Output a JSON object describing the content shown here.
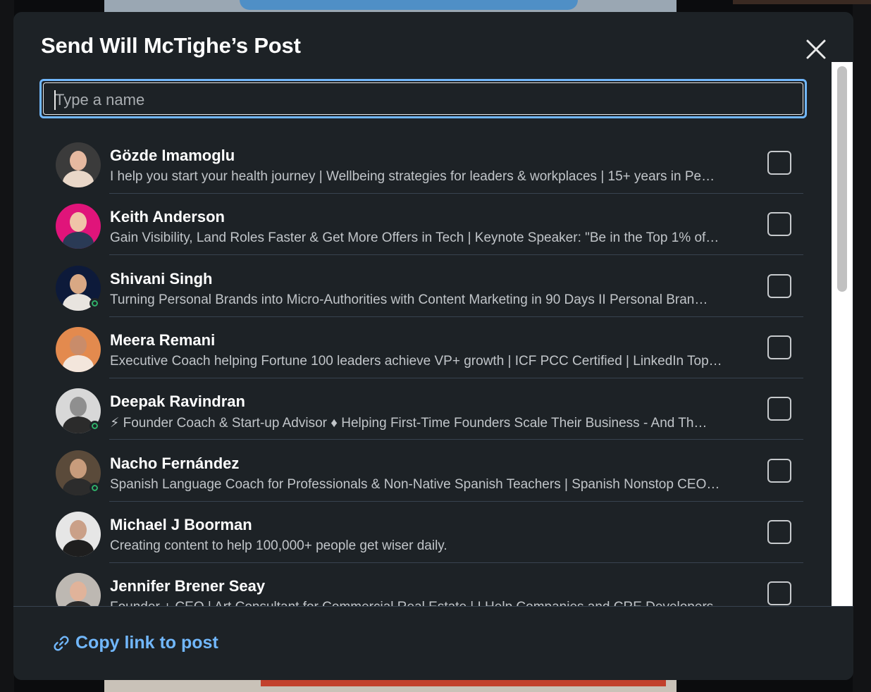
{
  "modal": {
    "title": "Send Will McTighe’s Post",
    "close_icon": "close-icon"
  },
  "search": {
    "placeholder": "Type a name",
    "value": ""
  },
  "contacts": [
    {
      "name": "Gözde Imamoglu",
      "headline": "I help you start your health journey | Wellbeing strategies for leaders & workplaces | 15+ years in Pe…",
      "online": false,
      "checked": false,
      "avatar_bg": "#3b3b3b",
      "avatar_skin": "#e6b9a0",
      "avatar_shirt": "#e9d7c8"
    },
    {
      "name": "Keith Anderson",
      "headline": "Gain Visibility, Land Roles Faster & Get More Offers in Tech | Keynote Speaker: \"Be in the Top 1% of…",
      "online": false,
      "checked": false,
      "avatar_bg": "#e0147a",
      "avatar_skin": "#f0c4a8",
      "avatar_shirt": "#2a3a55"
    },
    {
      "name": "Shivani Singh",
      "headline": "Turning Personal Brands into Micro-Authorities with Content Marketing in 90 Days II Personal Bran…",
      "online": true,
      "checked": false,
      "avatar_bg": "#0d1a3a",
      "avatar_skin": "#d9a884",
      "avatar_shirt": "#e8e4df"
    },
    {
      "name": "Meera Remani",
      "headline": "Executive Coach helping Fortune 100 leaders achieve VP+ growth | ICF PCC Certified | LinkedIn Top…",
      "online": false,
      "checked": false,
      "avatar_bg": "#e38a4e",
      "avatar_skin": "#c98c6a",
      "avatar_shirt": "#f3e6dc"
    },
    {
      "name": "Deepak Ravindran",
      "headline": "⚡ Founder Coach & Start-up Advisor ♦ Helping First-Time Founders Scale Their Business - And Th…",
      "online": true,
      "checked": false,
      "avatar_bg": "#d8d8d8",
      "avatar_skin": "#8f8f8f",
      "avatar_shirt": "#2b2b2b"
    },
    {
      "name": "Nacho Fernández",
      "headline": "Spanish Language Coach for Professionals & Non-Native Spanish Teachers | Spanish Nonstop CEO…",
      "online": true,
      "checked": false,
      "avatar_bg": "#5a4a3a",
      "avatar_skin": "#c89c7c",
      "avatar_shirt": "#2c2c2c"
    },
    {
      "name": "Michael J Boorman",
      "headline": "Creating content to help 100,000+ people get wiser daily.",
      "online": false,
      "checked": false,
      "avatar_bg": "#e6e6e6",
      "avatar_skin": "#caa088",
      "avatar_shirt": "#1e1e1e"
    },
    {
      "name": "Jennifer Brener Seay",
      "headline": "Founder + CEO | Art Consultant for Commercial Real Estate | I Help Companies and CRE Developers…",
      "online": false,
      "checked": false,
      "avatar_bg": "#bdb8b2",
      "avatar_skin": "#e0b39a",
      "avatar_shirt": "#2a2a2a"
    }
  ],
  "footer": {
    "copy_link_label": "Copy link to post",
    "copy_link_icon": "link-icon"
  },
  "colors": {
    "modal_bg": "#1d2226",
    "accent": "#71b7fb",
    "online": "#30b46b"
  }
}
